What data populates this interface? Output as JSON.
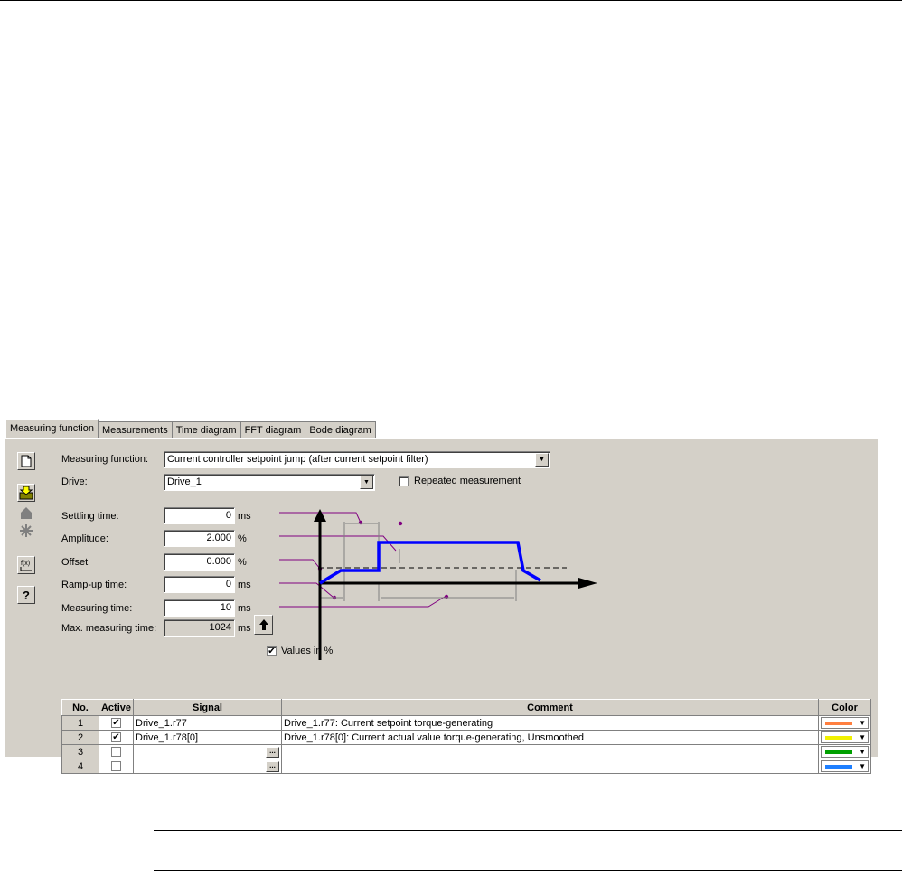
{
  "tabs": [
    {
      "label": "Measuring function",
      "active": true
    },
    {
      "label": "Measurements",
      "active": false
    },
    {
      "label": "Time diagram",
      "active": false
    },
    {
      "label": "FFT diagram",
      "active": false
    },
    {
      "label": "Bode diagram",
      "active": false
    }
  ],
  "toolbar": {
    "icons": [
      "new-document-icon",
      "download-icon",
      "home-icon",
      "stop-icon",
      "function-icon",
      "help-icon"
    ],
    "help_label": "?",
    "function_label": "f(x)"
  },
  "form": {
    "measuring_function_label": "Measuring function:",
    "measuring_function_value": "Current controller setpoint jump (after current setpoint filter)",
    "drive_label": "Drive:",
    "drive_value": "Drive_1",
    "repeated_label": "Repeated measurement",
    "repeated_checked": false,
    "settling_label": "Settling time:",
    "settling_value": "0",
    "settling_unit": "ms",
    "amplitude_label": "Amplitude:",
    "amplitude_value": "2.000",
    "amplitude_unit": "%",
    "offset_label": "Offset",
    "offset_value": "0.000",
    "offset_unit": "%",
    "rampup_label": "Ramp-up time:",
    "rampup_value": "0",
    "rampup_unit": "ms",
    "measuring_time_label": "Measuring time:",
    "measuring_time_value": "10",
    "measuring_time_unit": "ms",
    "max_time_label": "Max. measuring time:",
    "max_time_value": "1024",
    "max_time_unit": "ms",
    "values_percent_label": "Values in %",
    "values_percent_checked": true,
    "check_mark": "✔"
  },
  "table": {
    "headers": [
      "No.",
      "Active",
      "Signal",
      "Comment",
      "Color"
    ],
    "rows": [
      {
        "no": "1",
        "active": true,
        "signal": "Drive_1.r77",
        "comment": "Drive_1.r77: Current setpoint torque-generating",
        "color": "#ff7f3f"
      },
      {
        "no": "2",
        "active": true,
        "signal": "Drive_1.r78[0]",
        "comment": "Drive_1.r78[0]: Current actual value torque-generating, Unsmoothed",
        "color": "#f0f000"
      },
      {
        "no": "3",
        "active": false,
        "signal": "",
        "comment": "",
        "color": "#00a000"
      },
      {
        "no": "4",
        "active": false,
        "signal": "",
        "comment": "",
        "color": "#1e7fff"
      }
    ],
    "ellipsis": "..."
  },
  "colors": {
    "panel_bg": "#d4d0c8",
    "signal_curve": "#0000ff",
    "leader_lines": "#800080"
  }
}
